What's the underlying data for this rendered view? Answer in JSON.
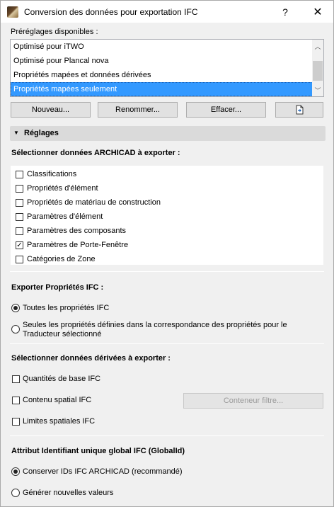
{
  "window": {
    "title": "Conversion des données pour exportation IFC",
    "help_glyph": "?",
    "close_glyph": "✕"
  },
  "presets": {
    "label": "Préréglages disponibles :",
    "items": [
      "Optimisé pour iTWO",
      "Optimisé pour Plancal nova",
      "Propriétés mapées et données dérivées",
      "Propriétés mapées seulement"
    ],
    "selected_index": 3
  },
  "buttons": {
    "new": "Nouveau...",
    "rename": "Renommer...",
    "delete": "Effacer...",
    "import_icon": "import-file-icon"
  },
  "settings": {
    "title": "Réglages",
    "archicad_label": "Sélectionner données ARCHICAD à exporter :",
    "archicad_items": [
      {
        "label": "Classifications",
        "checked": false
      },
      {
        "label": "Propriétés d'élément",
        "checked": false
      },
      {
        "label": "Propriétés de matériau de construction",
        "checked": false
      },
      {
        "label": "Paramètres d'élément",
        "checked": false
      },
      {
        "label": "Paramètres des composants",
        "checked": false
      },
      {
        "label": "Paramètres de Porte-Fenêtre",
        "checked": true
      },
      {
        "label": "Catégories de Zone",
        "checked": false
      }
    ],
    "ifc_props_label": "Exporter Propriétés IFC :",
    "ifc_props_all": "Toutes les propriétés IFC",
    "ifc_props_defined_line1": "Seules les propriétés définies dans la correspondance des propriétés pour le",
    "ifc_props_defined_line2": "Traducteur sélectionné",
    "derived_label": "Sélectionner données dérivées à exporter :",
    "derived_base_quantities": "Quantités de base IFC",
    "derived_spatial_container": "Contenu spatial IFC",
    "container_filter_button": "Conteneur filtre...",
    "derived_space_boundaries": "Limites spatiales IFC",
    "globalid_label": "Attribut Identifiant unique global IFC (GlobalId)",
    "globalid_keep": "Conserver IDs IFC ARCHICAD (recommandé)",
    "globalid_new": "Générer nouvelles valeurs"
  }
}
